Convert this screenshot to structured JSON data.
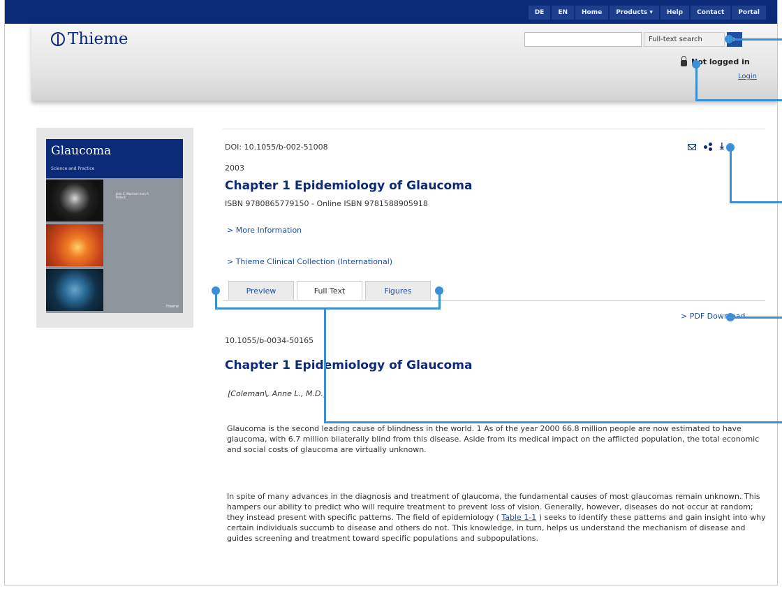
{
  "topnav": [
    "DE",
    "EN",
    "Home",
    "Products ▾",
    "Help",
    "Contact",
    "Portal"
  ],
  "brand": {
    "name": "Thieme"
  },
  "search": {
    "value": "",
    "mode": "Full-text search",
    "go_icon": "arrow-right-icon"
  },
  "auth": {
    "status": "Not logged in",
    "login": "Login"
  },
  "cover": {
    "title": "Glaucoma",
    "subtitle": "Science and Practice",
    "authors": "John C. Morrison Irvin P. Pollack",
    "publisher": "Thieme"
  },
  "doc": {
    "doi": "DOI: 10.1055/b-002-51008",
    "year": "2003",
    "title": "Chapter 1 Epidemiology of Glaucoma",
    "isbn": "ISBN 9780865779150 - Online ISBN 9781588905918",
    "more_info": "> More Information",
    "collection": "> Thieme Clinical Collection (International)"
  },
  "tabs": [
    "Preview",
    "Full Text",
    "Figures"
  ],
  "active_tab": "Full Text",
  "pdf_download": "> PDF Download",
  "fulltext": {
    "doi": "10.1055/b-0034-50165",
    "title": "Chapter 1 Epidemiology of Glaucoma",
    "author": "[Coleman\\, Anne L., M.D.]",
    "para1": "Glaucoma is the second leading cause of blindness in the world. 1 As of the year 2000 66.8 million people are now estimated to have glaucoma, with 6.7 million bilaterally blind from this disease. Aside from its medical impact on the afflicted population, the total economic and social costs of glaucoma are virtually unknown.",
    "para2_a": "In spite of many advances in the diagnosis and treatment of glaucoma, the fundamental causes of most glaucomas remain unknown. This hampers our ability to predict who will require treatment to prevent loss of vision. Generally, however, diseases do not occur at random; they instead present with specific patterns. The field of epidemiology ( ",
    "para2_link": "Table 1-1",
    "para2_b": " ) seeks to identify these patterns and gain insight into why certain individuals succumb to disease and others do not. This knowledge, in turn, helps us understand the mechanism of disease and guides screening and treatment toward specific populations and subpopulations."
  },
  "colors": {
    "brand": "#0b2b78",
    "link": "#1d4fa3",
    "callout": "#3a8fd6"
  }
}
